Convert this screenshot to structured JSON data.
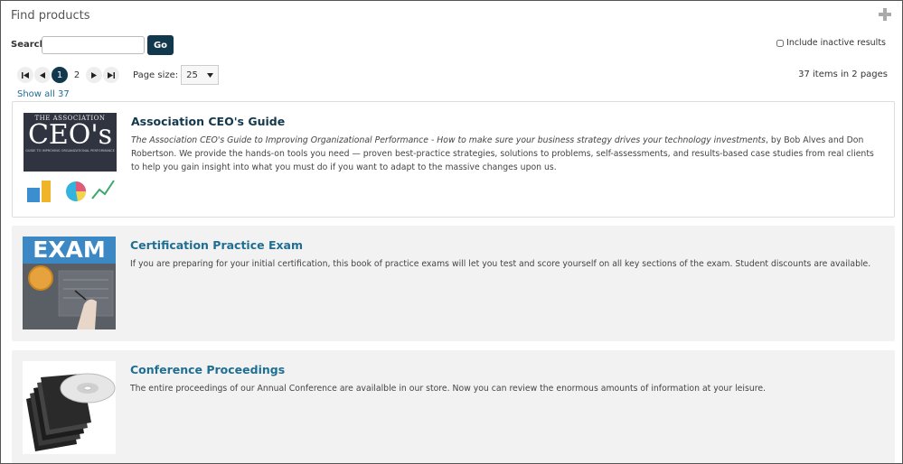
{
  "header": {
    "title": "Find products"
  },
  "search": {
    "label": "Search",
    "value": "",
    "placeholder": "",
    "go_label": "Go",
    "include_inactive_label": "Include inactive results"
  },
  "pager": {
    "first_glyph": "⏮",
    "prev_glyph": "◀",
    "pages": [
      "1",
      "2"
    ],
    "current_page": "1",
    "next_glyph": "▶",
    "last_glyph": "⏭",
    "page_size_label": "Page size:",
    "page_size_value": "25",
    "items_summary": "37 items in 2 pages",
    "show_all": "Show all 37"
  },
  "products": [
    {
      "title": "Association CEO's Guide",
      "desc_italic": "The Association CEO's Guide to Improving Organizational Performance - How to make sure your business strategy drives your technology investments",
      "desc_rest": ", by Bob Alves and Don Robertson. We provide the hands-on tools you need — proven best-practice strategies, solutions to problems, self-assessments, and results-based case studies from real clients to help you gain insight into what you must do if you want to adapt to the massive changes upon us.",
      "cover_top": "THE ASSOCIATION",
      "cover_big": "CEO's",
      "cover_sub": "GUIDE TO IMPROVING ORGANIZATIONAL PERFORMANCE"
    },
    {
      "title": "Certification Practice Exam",
      "desc": "If you are preparing for your initial certification, this book of practice exams will let you test and score yourself on all key sections of the exam. Student discounts are available.",
      "cover_big": "EXAM"
    },
    {
      "title": "Conference Proceedings",
      "desc": "The entire proceedings of our Annual Conference are availalble in our store. Now you can review the enormous amounts of information at your leisure."
    }
  ],
  "colors": {
    "primary": "#12384d",
    "link": "#1f6e93"
  }
}
